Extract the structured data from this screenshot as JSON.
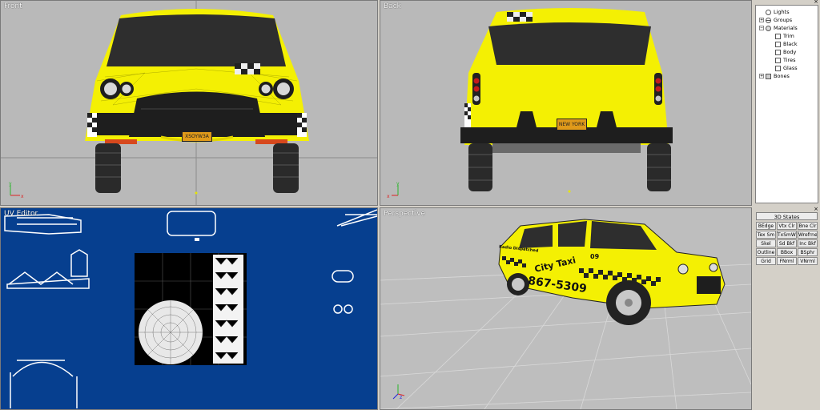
{
  "viewports": {
    "front": {
      "label": "Front"
    },
    "back": {
      "label": "Back"
    },
    "uv": {
      "label": "UV Editor"
    },
    "perspective": {
      "label": "Perspective"
    }
  },
  "car": {
    "front_plate": "XSOYW3A",
    "back_plate": "NEW YORK",
    "side_company": "City Taxi",
    "side_phone": "867-5309",
    "side_dispatch": "Radio Dispatched",
    "roof_number": "09",
    "colors": {
      "body": "#f4f003",
      "dark": "#1e1e1e",
      "glass": "#333333",
      "plate": "#e09a1a"
    }
  },
  "scene_tree": {
    "items": [
      {
        "label": "Lights",
        "expander": "",
        "icon": "light-icon",
        "indent": 0
      },
      {
        "label": "Groups",
        "expander": "+",
        "icon": "group-icon",
        "indent": 0
      },
      {
        "label": "Materials",
        "expander": "−",
        "icon": "material-icon",
        "indent": 0
      },
      {
        "label": "Trim",
        "expander": "",
        "icon": "material-item-icon",
        "indent": 1
      },
      {
        "label": "Black",
        "expander": "",
        "icon": "material-item-icon",
        "indent": 1
      },
      {
        "label": "Body",
        "expander": "",
        "icon": "material-item-icon",
        "indent": 1
      },
      {
        "label": "Tires",
        "expander": "",
        "icon": "material-item-icon",
        "indent": 1
      },
      {
        "label": "Glass",
        "expander": "",
        "icon": "material-item-icon",
        "indent": 1
      },
      {
        "label": "Bones",
        "expander": "+",
        "icon": "bone-icon",
        "indent": 0
      }
    ]
  },
  "states_panel": {
    "title": "3D States",
    "buttons": [
      "BEdge",
      "Vtx Clr",
      "Bne Clr",
      "Tex Sm",
      "TxSmWr",
      "Wrefrne",
      "Skel",
      "Sd Bkf",
      "Inc Bkf",
      "Outline",
      "BBox",
      "BSphr",
      "Grid",
      "FNrml",
      "VNrml"
    ]
  }
}
